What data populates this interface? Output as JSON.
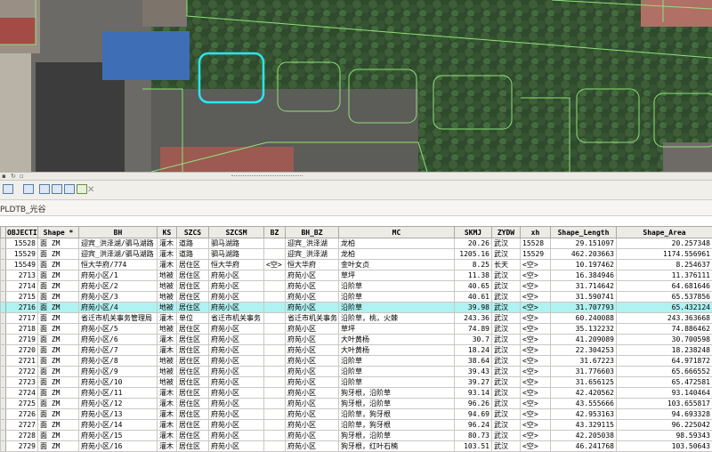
{
  "app": {
    "tab_label": "PLDTB_光谷",
    "colors": {
      "highlight_row": "#aef2f2",
      "selected_polygon": "#29e6f0",
      "polygon": "#8fe27a"
    }
  },
  "toolbar": {
    "icons": [
      "table-options-icon",
      "related-tables-icon",
      "select-by-attributes-icon",
      "switch-selection-icon",
      "clear-selection-icon",
      "zoom-to-selected-icon",
      "delete-selected-icon"
    ]
  },
  "attribute_table": {
    "columns": [
      "OBJECTI",
      "Shape *",
      "BH",
      "KS",
      "SZCS",
      "SZCSM",
      "BZ",
      "BH_BZ",
      "MC",
      "SKMJ",
      "ZYDW",
      "xh",
      "Shape_Length",
      "Shape_Area"
    ],
    "rows": [
      [
        "15528",
        "面 ZM",
        "迎宾_洪泽湖/驷马湖路",
        "灌木",
        "道路",
        "驷马湖路",
        "",
        "迎宾_洪泽湖",
        "龙柏",
        "20.26",
        "武汉",
        "15528",
        "29.151097",
        "20.257348"
      ],
      [
        "15529",
        "面 ZM",
        "迎宾_洪泽湖/驷马湖路",
        "灌木",
        "道路",
        "驷马湖路",
        "",
        "迎宾_洪泽湖",
        "龙柏",
        "1205.16",
        "武汉",
        "15529",
        "462.203663",
        "1174.556961"
      ],
      [
        "15549",
        "面 ZM",
        "恒大华府/774",
        "灌木",
        "居住区",
        "恒大华府",
        "<空>",
        "恒大华府",
        "金叶女贞",
        "8.25",
        "长天",
        "<空>",
        "10.197462",
        "8.254637"
      ],
      [
        "2713",
        "面 ZM",
        "府苑小区/1",
        "地被",
        "居住区",
        "府苑小区",
        "",
        "府苑小区",
        "草坪",
        "11.38",
        "武汉",
        "<空>",
        "16.384946",
        "11.376111"
      ],
      [
        "2714",
        "面 ZM",
        "府苑小区/2",
        "地被",
        "居住区",
        "府苑小区",
        "",
        "府苑小区",
        "沿阶草",
        "40.65",
        "武汉",
        "<空>",
        "31.714642",
        "64.681646"
      ],
      [
        "2715",
        "面 ZM",
        "府苑小区/3",
        "地被",
        "居住区",
        "府苑小区",
        "",
        "府苑小区",
        "沿阶草",
        "40.61",
        "武汉",
        "<空>",
        "31.590741",
        "65.537856"
      ],
      [
        "2716",
        "面 ZM",
        "府苑小区/4",
        "地被",
        "居住区",
        "府苑小区",
        "",
        "府苑小区",
        "沿阶草",
        "39.98",
        "武汉",
        "<空>",
        "31.707793",
        "65.432124"
      ],
      [
        "2717",
        "面 ZM",
        "省迁市机关事务管理局",
        "灌木",
        "单位",
        "省迁市机关事务",
        "",
        "省迁市机关事务",
        "沿阶草，桃，火棘",
        "243.36",
        "武汉",
        "<空>",
        "60.240088",
        "243.363668"
      ],
      [
        "2718",
        "面 ZM",
        "府苑小区/5",
        "地被",
        "居住区",
        "府苑小区",
        "",
        "府苑小区",
        "草坪",
        "74.89",
        "武汉",
        "<空>",
        "35.132232",
        "74.886462"
      ],
      [
        "2719",
        "面 ZM",
        "府苑小区/6",
        "灌木",
        "居住区",
        "府苑小区",
        "",
        "府苑小区",
        "大叶黄杨",
        "30.7",
        "武汉",
        "<空>",
        "41.209089",
        "30.700598"
      ],
      [
        "2720",
        "面 ZM",
        "府苑小区/7",
        "灌木",
        "居住区",
        "府苑小区",
        "",
        "府苑小区",
        "大叶黄杨",
        "18.24",
        "武汉",
        "<空>",
        "22.304253",
        "18.238248"
      ],
      [
        "2721",
        "面 ZM",
        "府苑小区/8",
        "地被",
        "居住区",
        "府苑小区",
        "",
        "府苑小区",
        "沿阶草",
        "38.64",
        "武汉",
        "<空>",
        "31.67223",
        "64.971872"
      ],
      [
        "2722",
        "面 ZM",
        "府苑小区/9",
        "地被",
        "居住区",
        "府苑小区",
        "",
        "府苑小区",
        "沿阶草",
        "39.43",
        "武汉",
        "<空>",
        "31.776603",
        "65.666552"
      ],
      [
        "2723",
        "面 ZM",
        "府苑小区/10",
        "地被",
        "居住区",
        "府苑小区",
        "",
        "府苑小区",
        "沿阶草",
        "39.27",
        "武汉",
        "<空>",
        "31.656125",
        "65.472581"
      ],
      [
        "2724",
        "面 ZM",
        "府苑小区/11",
        "灌木",
        "居住区",
        "府苑小区",
        "",
        "府苑小区",
        "狗牙根，沿阶草",
        "93.14",
        "武汉",
        "<空>",
        "42.420562",
        "93.140464"
      ],
      [
        "2725",
        "面 ZM",
        "府苑小区/12",
        "灌木",
        "居住区",
        "府苑小区",
        "",
        "府苑小区",
        "狗牙根，沿阶草",
        "96.26",
        "武汉",
        "<空>",
        "43.555666",
        "103.655817"
      ],
      [
        "2726",
        "面 ZM",
        "府苑小区/13",
        "灌木",
        "居住区",
        "府苑小区",
        "",
        "府苑小区",
        "沿阶草，狗牙根",
        "94.69",
        "武汉",
        "<空>",
        "42.953163",
        "94.693328"
      ],
      [
        "2727",
        "面 ZM",
        "府苑小区/14",
        "灌木",
        "居住区",
        "府苑小区",
        "",
        "府苑小区",
        "沿阶草，狗牙根",
        "96.24",
        "武汉",
        "<空>",
        "43.329115",
        "96.225042"
      ],
      [
        "2728",
        "面 ZM",
        "府苑小区/15",
        "灌木",
        "居住区",
        "府苑小区",
        "",
        "府苑小区",
        "狗牙根，沿阶草",
        "80.73",
        "武汉",
        "<空>",
        "42.205038",
        "98.59343"
      ],
      [
        "2729",
        "面 ZM",
        "府苑小区/16",
        "灌木",
        "居住区",
        "府苑小区",
        "",
        "府苑小区",
        "狗牙根，红叶石楠",
        "103.51",
        "武汉",
        "<空>",
        "46.241768",
        "103.50643"
      ]
    ],
    "highlighted_row_index": 6
  }
}
